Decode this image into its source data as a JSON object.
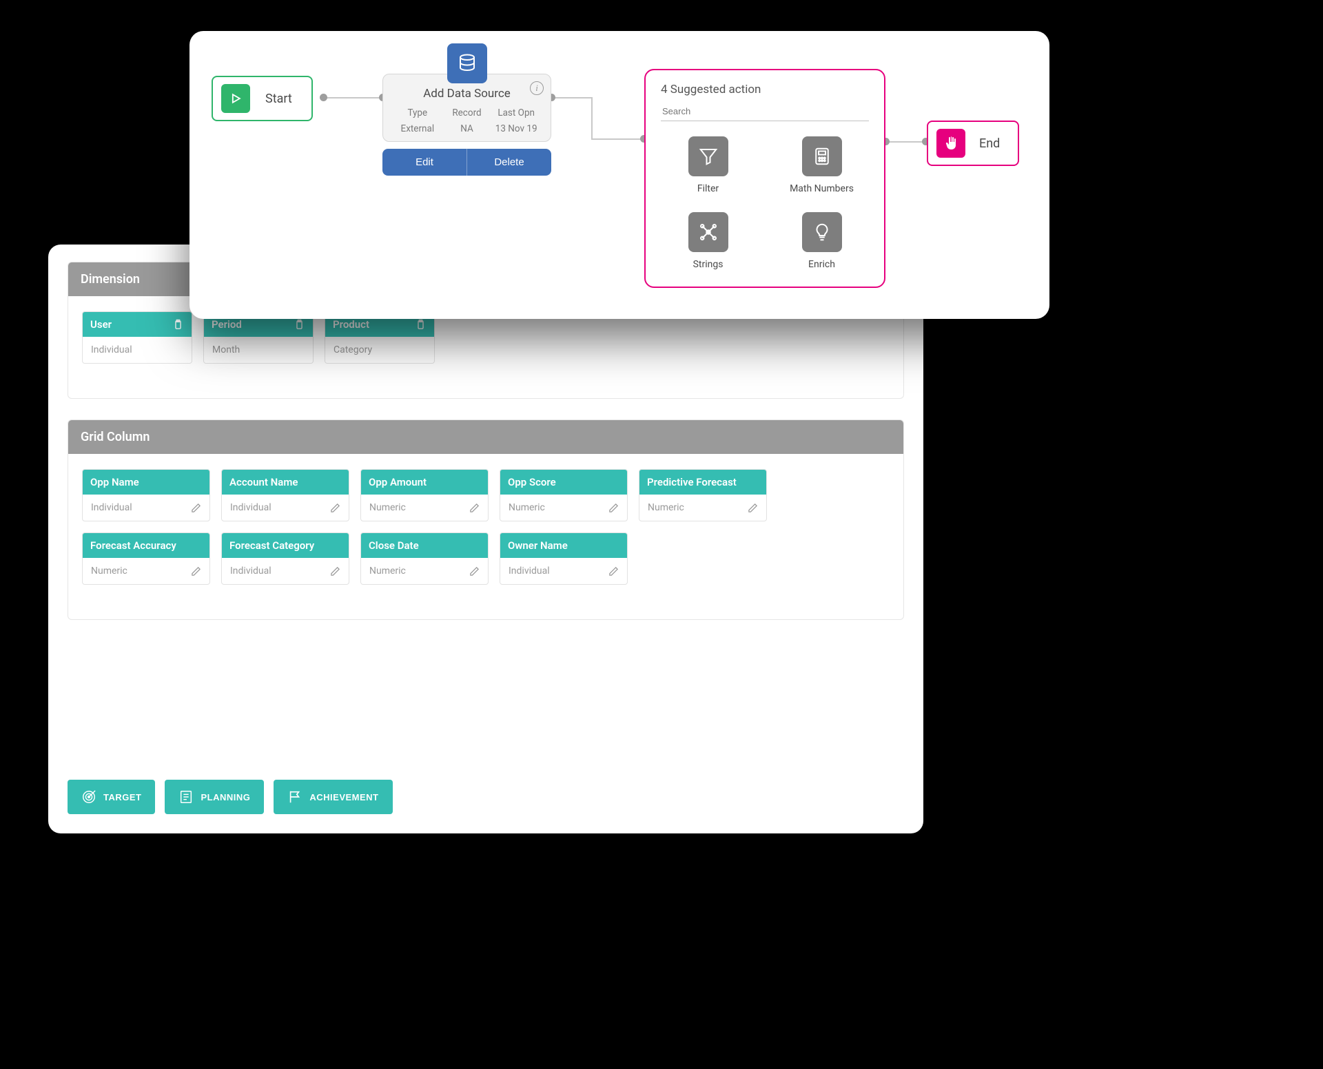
{
  "flow": {
    "start_label": "Start",
    "end_label": "End",
    "datasource": {
      "title": "Add Data Source",
      "headers": {
        "col1": "Type",
        "col2": "Record",
        "col3": "Last Opn"
      },
      "values": {
        "col1": "External",
        "col2": "NA",
        "col3": "13 Nov 19"
      },
      "edit_label": "Edit",
      "delete_label": "Delete"
    },
    "suggested": {
      "title": "4 Suggested action",
      "search_placeholder": "Search",
      "items": [
        {
          "label": "Filter"
        },
        {
          "label": "Math Numbers"
        },
        {
          "label": "Strings"
        },
        {
          "label": "Enrich"
        }
      ]
    }
  },
  "dimension": {
    "title": "Dimension",
    "items": [
      {
        "name": "User",
        "value": "Individual"
      },
      {
        "name": "Period",
        "value": "Month"
      },
      {
        "name": "Product",
        "value": "Category"
      }
    ]
  },
  "grid": {
    "title": "Grid Column",
    "items": [
      {
        "name": "Opp Name",
        "value": "Individual"
      },
      {
        "name": "Account Name",
        "value": "Individual"
      },
      {
        "name": "Opp Amount",
        "value": "Numeric"
      },
      {
        "name": "Opp Score",
        "value": "Numeric"
      },
      {
        "name": "Predictive Forecast",
        "value": "Numeric"
      },
      {
        "name": "Forecast Accuracy",
        "value": "Numeric"
      },
      {
        "name": "Forecast Category",
        "value": "Individual"
      },
      {
        "name": "Close Date",
        "value": "Numeric"
      },
      {
        "name": "Owner Name",
        "value": "Individual"
      }
    ]
  },
  "buttons": {
    "target": "TARGET",
    "planning": "PLANNING",
    "achievement": "ACHIEVEMENT"
  }
}
